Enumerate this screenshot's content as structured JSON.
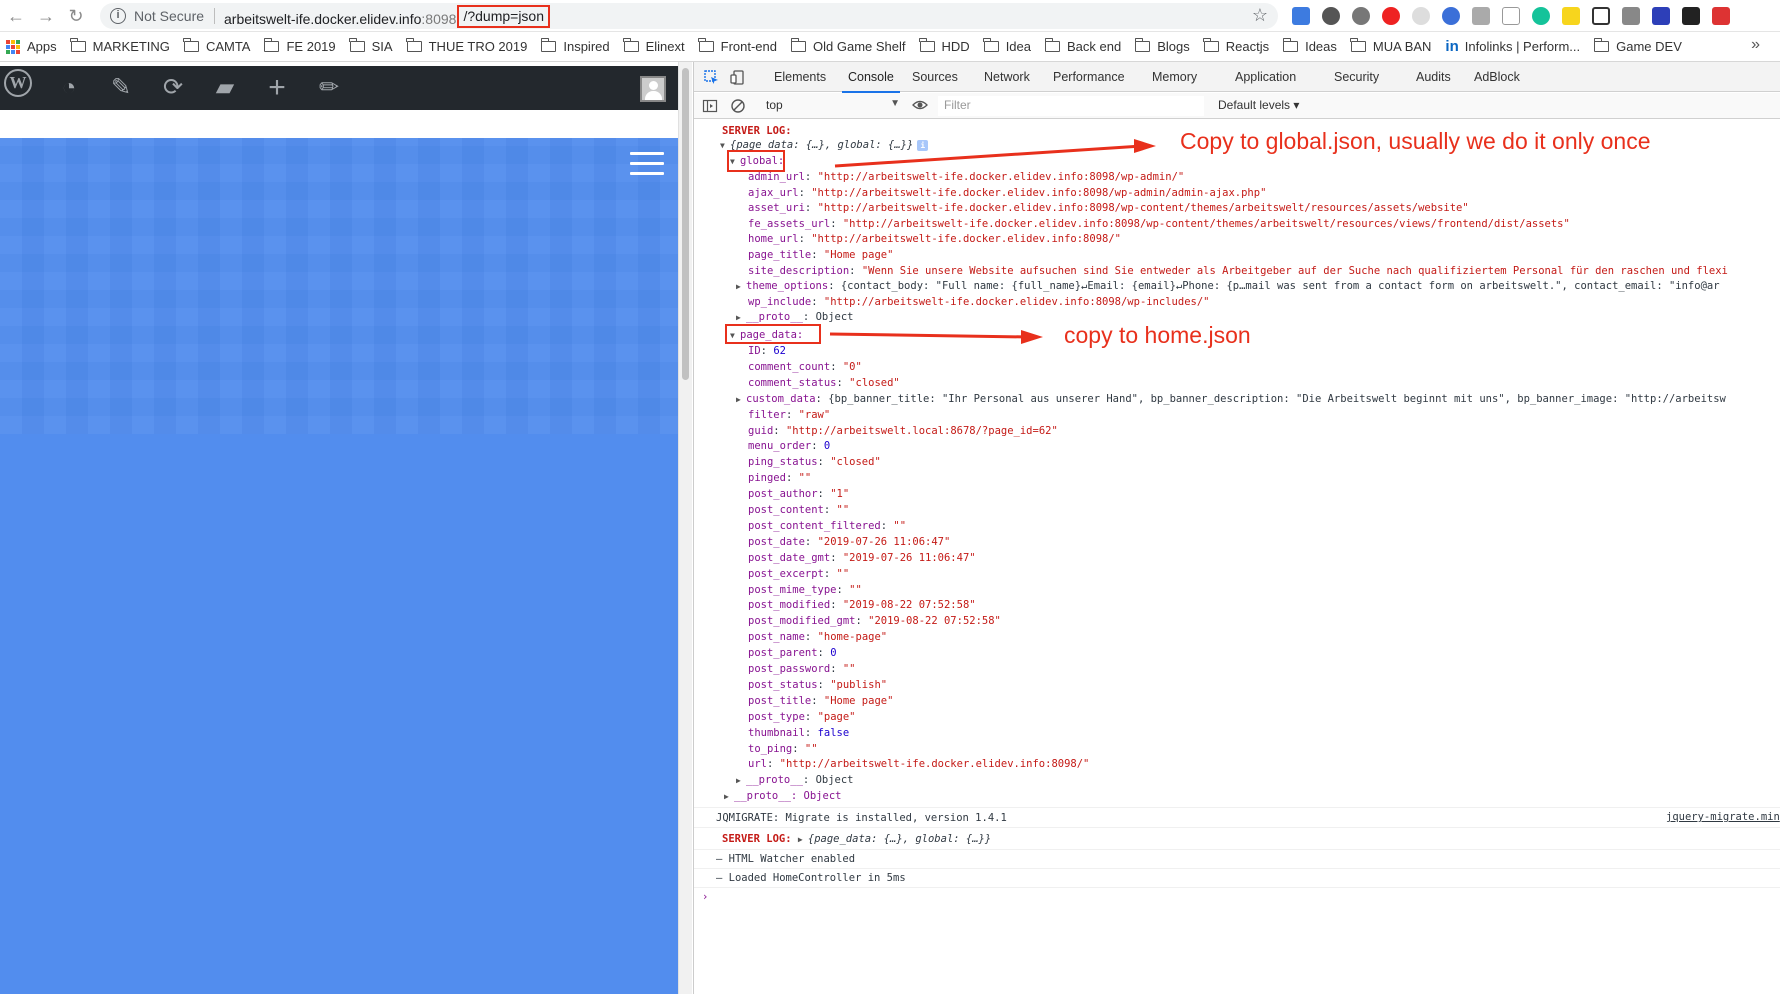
{
  "browser": {
    "not_secure": "Not Secure",
    "url_host": "arbeitswelt-ife.docker.elidev.info",
    "url_port": ":8098",
    "url_query": "/?dump=json"
  },
  "bookmarks": [
    {
      "label": "Apps",
      "icon": "apps-grid-icon"
    },
    {
      "label": "MARKETING",
      "icon": "folder-icon"
    },
    {
      "label": "CAMTA",
      "icon": "folder-icon"
    },
    {
      "label": "FE 2019",
      "icon": "folder-icon"
    },
    {
      "label": "SIA",
      "icon": "folder-icon"
    },
    {
      "label": "THUE TRO 2019",
      "icon": "folder-icon"
    },
    {
      "label": "Inspired",
      "icon": "folder-icon"
    },
    {
      "label": "Elinext",
      "icon": "folder-icon"
    },
    {
      "label": "Front-end",
      "icon": "folder-icon"
    },
    {
      "label": "Old Game Shelf",
      "icon": "folder-icon"
    },
    {
      "label": "HDD",
      "icon": "folder-icon"
    },
    {
      "label": "Idea",
      "icon": "folder-icon"
    },
    {
      "label": "Back end",
      "icon": "folder-icon"
    },
    {
      "label": "Blogs",
      "icon": "folder-icon"
    },
    {
      "label": "Reactjs",
      "icon": "folder-icon"
    },
    {
      "label": "Ideas",
      "icon": "folder-icon"
    },
    {
      "label": "MUA BAN",
      "icon": "folder-icon"
    },
    {
      "label": "Infolinks | Perform...",
      "icon": "linkedin-icon"
    },
    {
      "label": "Game DEV",
      "icon": "folder-icon"
    }
  ],
  "bookmarks_more": "»",
  "devtools": {
    "tabs": [
      "Elements",
      "Console",
      "Sources",
      "Network",
      "Performance",
      "Memory",
      "Application",
      "Security",
      "Audits",
      "AdBlock"
    ],
    "active_tab": "Console",
    "context": "top",
    "filter_placeholder": "Filter",
    "levels": "Default levels ▾"
  },
  "console": {
    "server_log_label": "SERVER LOG:",
    "root_summary": "{page_data: {…}, global: {…}}",
    "global_key": "global:",
    "global_entries": [
      {
        "k": "admin_url",
        "v": "\"http://arbeitswelt-ife.docker.elidev.info:8098/wp-admin/\"",
        "t": "str"
      },
      {
        "k": "ajax_url",
        "v": "\"http://arbeitswelt-ife.docker.elidev.info:8098/wp-admin/admin-ajax.php\"",
        "t": "str"
      },
      {
        "k": "asset_uri",
        "v": "\"http://arbeitswelt-ife.docker.elidev.info:8098/wp-content/themes/arbeitswelt/resources/assets/website\"",
        "t": "str"
      },
      {
        "k": "fe_assets_url",
        "v": "\"http://arbeitswelt-ife.docker.elidev.info:8098/wp-content/themes/arbeitswelt/resources/views/frontend/dist/assets\"",
        "t": "str"
      },
      {
        "k": "home_url",
        "v": "\"http://arbeitswelt-ife.docker.elidev.info:8098/\"",
        "t": "str"
      },
      {
        "k": "page_title",
        "v": "\"Home page\"",
        "t": "str"
      },
      {
        "k": "site_description",
        "v": "\"Wenn Sie unsere Website aufsuchen sind Sie entweder als Arbeitgeber auf der Suche nach qualifiziertem Personal für den raschen und flexi",
        "t": "str"
      },
      {
        "k": "theme_options",
        "v": "{contact_body: \"Full name: {full_name}↵Email: {email}↵Phone: {p…mail was sent from a contact form on arbeitswelt.\", contact_email: \"info@ar",
        "t": "obj",
        "exp": true
      },
      {
        "k": "wp_include",
        "v": "\"http://arbeitswelt-ife.docker.elidev.info:8098/wp-includes/\"",
        "t": "str"
      },
      {
        "k": "__proto__",
        "v": "Object",
        "t": "obj",
        "exp": true
      }
    ],
    "page_data_key": "page_data:",
    "page_entries": [
      {
        "k": "ID",
        "v": "62",
        "t": "num"
      },
      {
        "k": "comment_count",
        "v": "\"0\"",
        "t": "str"
      },
      {
        "k": "comment_status",
        "v": "\"closed\"",
        "t": "str"
      },
      {
        "k": "custom_data",
        "v": "{bp_banner_title: \"Ihr Personal aus unserer Hand\", bp_banner_description: \"Die Arbeitswelt beginnt mit uns\", bp_banner_image: \"http://arbeitsw",
        "t": "obj",
        "exp": true
      },
      {
        "k": "filter",
        "v": "\"raw\"",
        "t": "str"
      },
      {
        "k": "guid",
        "v": "\"http://arbeitswelt.local:8678/?page_id=62\"",
        "t": "str"
      },
      {
        "k": "menu_order",
        "v": "0",
        "t": "num"
      },
      {
        "k": "ping_status",
        "v": "\"closed\"",
        "t": "str"
      },
      {
        "k": "pinged",
        "v": "\"\"",
        "t": "str"
      },
      {
        "k": "post_author",
        "v": "\"1\"",
        "t": "str"
      },
      {
        "k": "post_content",
        "v": "\"\"",
        "t": "str"
      },
      {
        "k": "post_content_filtered",
        "v": "\"\"",
        "t": "str"
      },
      {
        "k": "post_date",
        "v": "\"2019-07-26 11:06:47\"",
        "t": "str"
      },
      {
        "k": "post_date_gmt",
        "v": "\"2019-07-26 11:06:47\"",
        "t": "str"
      },
      {
        "k": "post_excerpt",
        "v": "\"\"",
        "t": "str"
      },
      {
        "k": "post_mime_type",
        "v": "\"\"",
        "t": "str"
      },
      {
        "k": "post_modified",
        "v": "\"2019-08-22 07:52:58\"",
        "t": "str"
      },
      {
        "k": "post_modified_gmt",
        "v": "\"2019-08-22 07:52:58\"",
        "t": "str"
      },
      {
        "k": "post_name",
        "v": "\"home-page\"",
        "t": "str"
      },
      {
        "k": "post_parent",
        "v": "0",
        "t": "num"
      },
      {
        "k": "post_password",
        "v": "\"\"",
        "t": "str"
      },
      {
        "k": "post_status",
        "v": "\"publish\"",
        "t": "str"
      },
      {
        "k": "post_title",
        "v": "\"Home page\"",
        "t": "str"
      },
      {
        "k": "post_type",
        "v": "\"page\"",
        "t": "str"
      },
      {
        "k": "thumbnail",
        "v": "false",
        "t": "num"
      },
      {
        "k": "to_ping",
        "v": "\"\"",
        "t": "str"
      },
      {
        "k": "url",
        "v": "\"http://arbeitswelt-ife.docker.elidev.info:8098/\"",
        "t": "str"
      },
      {
        "k": "__proto__",
        "v": "Object",
        "t": "obj",
        "exp": true
      }
    ],
    "outer_proto": "__proto__: Object",
    "jqmigrate": "JQMIGRATE: Migrate is installed, version 1.4.1",
    "jqmigrate_src": "jquery-migrate.min",
    "server_log_2": "{page_data: {…}, global: {…}}",
    "html_watcher": "– HTML Watcher enabled",
    "loaded": "– Loaded HomeController in 5ms",
    "prompt": "›"
  },
  "annotations": {
    "global_note": "Copy to global.json, usually we do it only once",
    "page_note": "copy to home.json"
  },
  "colors": {
    "annotation": "#e8301c",
    "site_blue": "#528dee",
    "wp_bar": "#23282d"
  }
}
